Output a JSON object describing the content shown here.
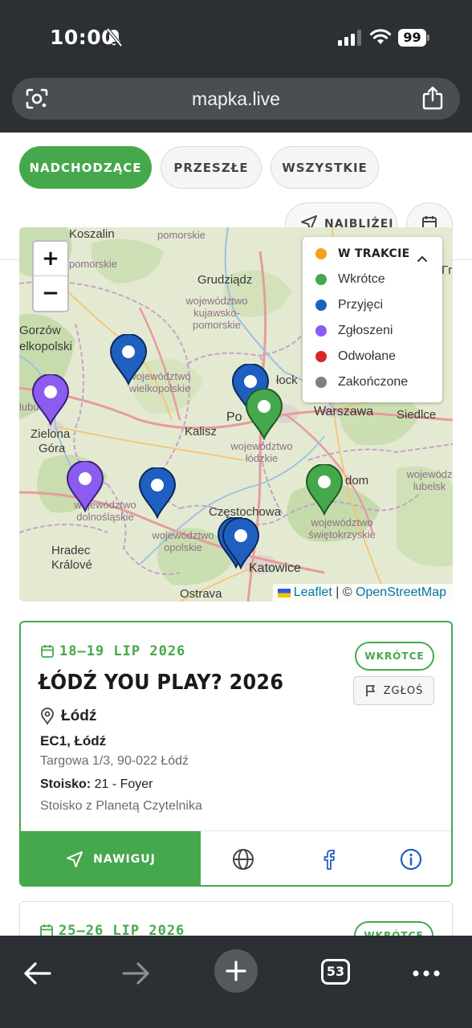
{
  "status_bar": {
    "time": "10:00",
    "battery": "99"
  },
  "browser": {
    "url": "mapka.live",
    "tab_count": "53"
  },
  "filters": {
    "upcoming": "NADCHODZĄCE",
    "past": "PRZESZŁE",
    "all": "WSZYSTKIE",
    "nearby": "NAJBLIŻEJ"
  },
  "map": {
    "zoom_in": "+",
    "zoom_out": "−",
    "legend": {
      "items": [
        {
          "label": "W TRAKCIE",
          "color": "#f5a01a"
        },
        {
          "label": "Wkrótce",
          "color": "#46a84c"
        },
        {
          "label": "Przyjęci",
          "color": "#1f5fbf"
        },
        {
          "label": "Zgłoszeni",
          "color": "#8b5cf0"
        },
        {
          "label": "Odwołane",
          "color": "#d7262e"
        },
        {
          "label": "Zakończone",
          "color": "#7d7f85"
        }
      ]
    },
    "attribution": {
      "leaflet": "Leaflet",
      "separator": " | © ",
      "osm": "OpenStreetMap"
    },
    "labels": {
      "koszalin": "Koszalin",
      "pomorskie_top": "pomorskie",
      "pomorskie_left": "pomorskie",
      "grudziadz": "Grudziądz",
      "kujawsko": "województwo kujawsko-pomorskie",
      "gorzow": "Gorzów",
      "wielkopolski_city": "elkopolski",
      "wielkopolskie": "województwo wielkopolskie",
      "lubu": "lubu",
      "zielona": "Zielona",
      "gora": "Góra",
      "kalisz": "Kalisz",
      "plock": "łock",
      "po": "Po",
      "lodzkie": "województwo łódzkie",
      "warszawa": "Warszawa",
      "siedlce": "Siedlce",
      "dom": "dom",
      "lubelskie": "wojewódz lubelsk",
      "dolnoslaskie": "województwo dolnośląskie",
      "opolskie": "województwo opolskie",
      "czestochowa": "Częstochowa",
      "swietokrzyskie": "województwo świętokrzyskie",
      "hradec": "Hradec",
      "kralove": "Králové",
      "katowice": "Katowice",
      "ostrava": "Ostrava",
      "right_edge": "Γr"
    }
  },
  "events": [
    {
      "date": "18–19 LIP 2026",
      "status": "WKRÓTCE",
      "report": "ZGŁOŚ",
      "title": "ŁÓDŹ YOU PLAY? 2026",
      "city": "Łódź",
      "venue": "EC1, Łódź",
      "address": "Targowa 1/3, 90-022 Łódź",
      "stand_label": "Stoisko:",
      "stand_value": " 21 - Foyer",
      "note": "Stoisko z Planetą Czytelnika",
      "navigate": "NAWIGUJ"
    },
    {
      "date": "25–26 LIP 2026",
      "status": "WKRÓTCE"
    }
  ]
}
